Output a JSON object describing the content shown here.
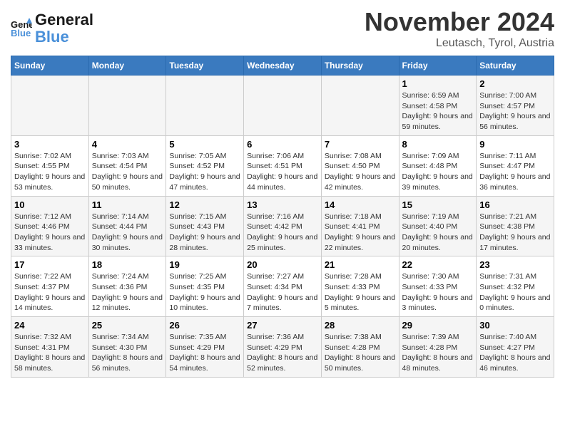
{
  "logo": {
    "line1": "General",
    "line2": "Blue"
  },
  "title": "November 2024",
  "location": "Leutasch, Tyrol, Austria",
  "days_of_week": [
    "Sunday",
    "Monday",
    "Tuesday",
    "Wednesday",
    "Thursday",
    "Friday",
    "Saturday"
  ],
  "weeks": [
    [
      {
        "day": "",
        "info": ""
      },
      {
        "day": "",
        "info": ""
      },
      {
        "day": "",
        "info": ""
      },
      {
        "day": "",
        "info": ""
      },
      {
        "day": "",
        "info": ""
      },
      {
        "day": "1",
        "info": "Sunrise: 6:59 AM\nSunset: 4:58 PM\nDaylight: 9 hours and 59 minutes."
      },
      {
        "day": "2",
        "info": "Sunrise: 7:00 AM\nSunset: 4:57 PM\nDaylight: 9 hours and 56 minutes."
      }
    ],
    [
      {
        "day": "3",
        "info": "Sunrise: 7:02 AM\nSunset: 4:55 PM\nDaylight: 9 hours and 53 minutes."
      },
      {
        "day": "4",
        "info": "Sunrise: 7:03 AM\nSunset: 4:54 PM\nDaylight: 9 hours and 50 minutes."
      },
      {
        "day": "5",
        "info": "Sunrise: 7:05 AM\nSunset: 4:52 PM\nDaylight: 9 hours and 47 minutes."
      },
      {
        "day": "6",
        "info": "Sunrise: 7:06 AM\nSunset: 4:51 PM\nDaylight: 9 hours and 44 minutes."
      },
      {
        "day": "7",
        "info": "Sunrise: 7:08 AM\nSunset: 4:50 PM\nDaylight: 9 hours and 42 minutes."
      },
      {
        "day": "8",
        "info": "Sunrise: 7:09 AM\nSunset: 4:48 PM\nDaylight: 9 hours and 39 minutes."
      },
      {
        "day": "9",
        "info": "Sunrise: 7:11 AM\nSunset: 4:47 PM\nDaylight: 9 hours and 36 minutes."
      }
    ],
    [
      {
        "day": "10",
        "info": "Sunrise: 7:12 AM\nSunset: 4:46 PM\nDaylight: 9 hours and 33 minutes."
      },
      {
        "day": "11",
        "info": "Sunrise: 7:14 AM\nSunset: 4:44 PM\nDaylight: 9 hours and 30 minutes."
      },
      {
        "day": "12",
        "info": "Sunrise: 7:15 AM\nSunset: 4:43 PM\nDaylight: 9 hours and 28 minutes."
      },
      {
        "day": "13",
        "info": "Sunrise: 7:16 AM\nSunset: 4:42 PM\nDaylight: 9 hours and 25 minutes."
      },
      {
        "day": "14",
        "info": "Sunrise: 7:18 AM\nSunset: 4:41 PM\nDaylight: 9 hours and 22 minutes."
      },
      {
        "day": "15",
        "info": "Sunrise: 7:19 AM\nSunset: 4:40 PM\nDaylight: 9 hours and 20 minutes."
      },
      {
        "day": "16",
        "info": "Sunrise: 7:21 AM\nSunset: 4:38 PM\nDaylight: 9 hours and 17 minutes."
      }
    ],
    [
      {
        "day": "17",
        "info": "Sunrise: 7:22 AM\nSunset: 4:37 PM\nDaylight: 9 hours and 14 minutes."
      },
      {
        "day": "18",
        "info": "Sunrise: 7:24 AM\nSunset: 4:36 PM\nDaylight: 9 hours and 12 minutes."
      },
      {
        "day": "19",
        "info": "Sunrise: 7:25 AM\nSunset: 4:35 PM\nDaylight: 9 hours and 10 minutes."
      },
      {
        "day": "20",
        "info": "Sunrise: 7:27 AM\nSunset: 4:34 PM\nDaylight: 9 hours and 7 minutes."
      },
      {
        "day": "21",
        "info": "Sunrise: 7:28 AM\nSunset: 4:33 PM\nDaylight: 9 hours and 5 minutes."
      },
      {
        "day": "22",
        "info": "Sunrise: 7:30 AM\nSunset: 4:33 PM\nDaylight: 9 hours and 3 minutes."
      },
      {
        "day": "23",
        "info": "Sunrise: 7:31 AM\nSunset: 4:32 PM\nDaylight: 9 hours and 0 minutes."
      }
    ],
    [
      {
        "day": "24",
        "info": "Sunrise: 7:32 AM\nSunset: 4:31 PM\nDaylight: 8 hours and 58 minutes."
      },
      {
        "day": "25",
        "info": "Sunrise: 7:34 AM\nSunset: 4:30 PM\nDaylight: 8 hours and 56 minutes."
      },
      {
        "day": "26",
        "info": "Sunrise: 7:35 AM\nSunset: 4:29 PM\nDaylight: 8 hours and 54 minutes."
      },
      {
        "day": "27",
        "info": "Sunrise: 7:36 AM\nSunset: 4:29 PM\nDaylight: 8 hours and 52 minutes."
      },
      {
        "day": "28",
        "info": "Sunrise: 7:38 AM\nSunset: 4:28 PM\nDaylight: 8 hours and 50 minutes."
      },
      {
        "day": "29",
        "info": "Sunrise: 7:39 AM\nSunset: 4:28 PM\nDaylight: 8 hours and 48 minutes."
      },
      {
        "day": "30",
        "info": "Sunrise: 7:40 AM\nSunset: 4:27 PM\nDaylight: 8 hours and 46 minutes."
      }
    ]
  ]
}
